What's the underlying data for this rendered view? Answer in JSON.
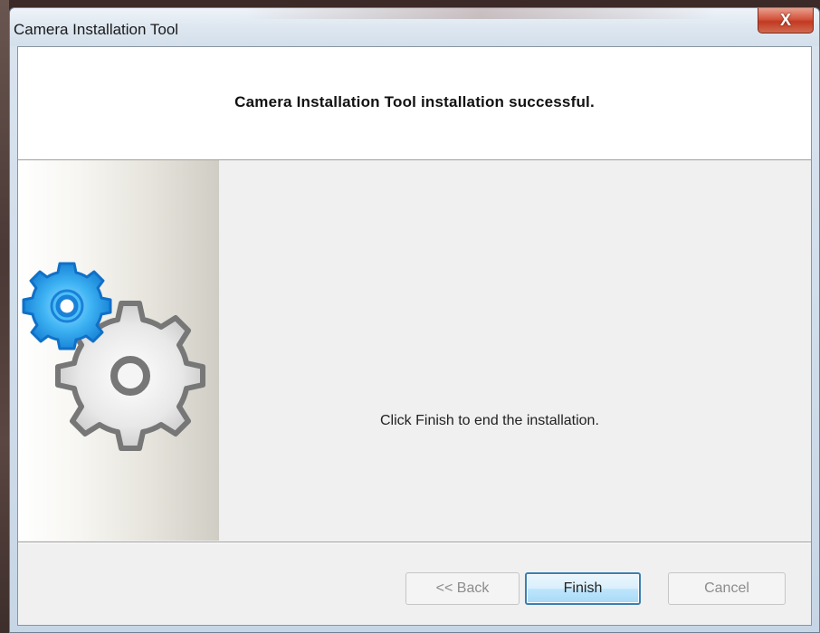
{
  "window": {
    "title": "Camera Installation Tool",
    "close_glyph": "X"
  },
  "header": {
    "title": "Camera Installation Tool installation successful."
  },
  "main": {
    "message": "Click Finish to end the installation."
  },
  "side_panel": {
    "icon": "gears-icon"
  },
  "buttons": {
    "back_label": "<< Back",
    "finish_label": "Finish",
    "cancel_label": "Cancel"
  },
  "colors": {
    "accent_gear": "#1e90e0",
    "gray_gear": "#8a8a8a",
    "close_button": "#c8412a",
    "primary_button_border": "#3c7fb1"
  }
}
